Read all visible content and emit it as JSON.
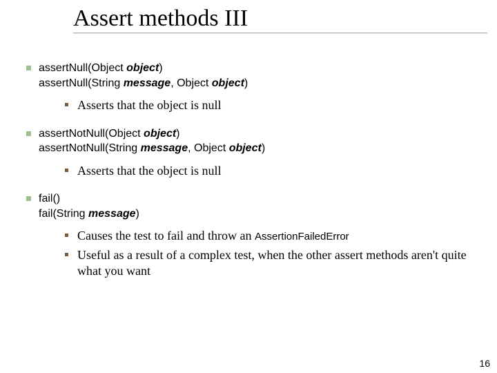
{
  "title": "Assert methods III",
  "items": [
    {
      "lines": [
        {
          "segments": [
            {
              "text": "assertNull(Object ",
              "cls": "sans"
            },
            {
              "text": "object",
              "cls": "sans ital"
            },
            {
              "text": ")",
              "cls": "sans"
            }
          ]
        },
        {
          "segments": [
            {
              "text": "assertNull(String ",
              "cls": "sans"
            },
            {
              "text": "message",
              "cls": "sans ital"
            },
            {
              "text": ", Object ",
              "cls": "sans"
            },
            {
              "text": "object",
              "cls": "sans ital"
            },
            {
              "text": ")",
              "cls": "sans"
            }
          ]
        }
      ],
      "sub": [
        {
          "segments": [
            {
              "text": "Asserts that the object is null",
              "cls": "serif"
            }
          ]
        }
      ]
    },
    {
      "lines": [
        {
          "segments": [
            {
              "text": "assertNotNull(Object ",
              "cls": "sans"
            },
            {
              "text": "object",
              "cls": "sans ital"
            },
            {
              "text": ")",
              "cls": "sans"
            }
          ]
        },
        {
          "segments": [
            {
              "text": "assertNotNull(String ",
              "cls": "sans"
            },
            {
              "text": "message",
              "cls": "sans ital"
            },
            {
              "text": ", Object ",
              "cls": "sans"
            },
            {
              "text": "object",
              "cls": "sans ital"
            },
            {
              "text": ")",
              "cls": "sans"
            }
          ]
        }
      ],
      "sub": [
        {
          "segments": [
            {
              "text": "Asserts that the object is null",
              "cls": "serif"
            }
          ]
        }
      ]
    },
    {
      "lines": [
        {
          "segments": [
            {
              "text": "fail()",
              "cls": "sans"
            }
          ]
        },
        {
          "segments": [
            {
              "text": "fail(String ",
              "cls": "sans"
            },
            {
              "text": "message",
              "cls": "sans ital"
            },
            {
              "text": ")",
              "cls": "sans"
            }
          ]
        }
      ],
      "sub": [
        {
          "segments": [
            {
              "text": "Causes the test to fail and throw an ",
              "cls": "serif"
            },
            {
              "text": "AssertionFailedError",
              "cls": "code-sans"
            }
          ]
        },
        {
          "segments": [
            {
              "text": "Useful as a result of a complex test, when the other assert methods aren't quite what you want",
              "cls": "serif"
            }
          ]
        }
      ]
    }
  ],
  "page_number": "16"
}
